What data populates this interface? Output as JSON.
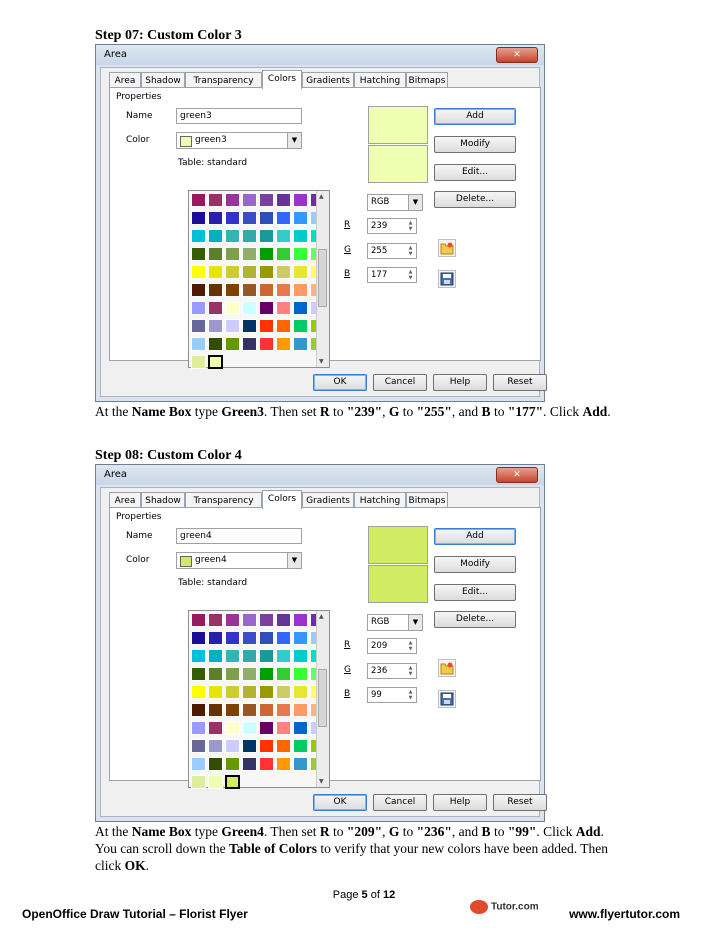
{
  "steps": [
    {
      "title": "Step 07: Custom Color 3",
      "dialog": {
        "title": "Area",
        "close": "✕",
        "tabs": [
          "Area",
          "Shadow",
          "Transparency",
          "Colors",
          "Gradients",
          "Hatching",
          "Bitmaps"
        ],
        "active_tab": "Colors",
        "group_label": "Properties",
        "name_label": "Name",
        "name_value": "green3",
        "color_label": "Color",
        "color_value": "green3",
        "color_swatch": "#efffb1",
        "table_label": "Table: standard",
        "preview_top": "#efffb1",
        "preview_bottom": "#efffb1",
        "buttons": {
          "add": "Add",
          "modify": "Modify",
          "edit": "Edit...",
          "delete": "Delete..."
        },
        "model": "RGB",
        "r_label": "R",
        "g_label": "G",
        "b_label": "B",
        "r": "239",
        "g": "255",
        "b": "177",
        "custom_cells": [
          "#dfee9b",
          "#efffb1"
        ],
        "selected_custom": 1,
        "footer_buttons": {
          "ok": "OK",
          "cancel": "Cancel",
          "help": "Help",
          "reset": "Reset"
        }
      },
      "paragraph_html": "At the <b>Name Box</b> type <b>Green3</b>. Then set <b>R</b> to <b>\"239\"</b>, <b>G</b> to <b>\"255\"</b>, and <b>B</b> to <b>\"177\"</b>. Click <b>Add</b>."
    },
    {
      "title": "Step 08: Custom Color 4",
      "dialog": {
        "title": "Area",
        "close": "✕",
        "tabs": [
          "Area",
          "Shadow",
          "Transparency",
          "Colors",
          "Gradients",
          "Hatching",
          "Bitmaps"
        ],
        "active_tab": "Colors",
        "group_label": "Properties",
        "name_label": "Name",
        "name_value": "green4",
        "color_label": "Color",
        "color_value": "green4",
        "color_swatch": "#d1ec63",
        "table_label": "Table: standard",
        "preview_top": "#d1ec63",
        "preview_bottom": "#d1ec63",
        "buttons": {
          "add": "Add",
          "modify": "Modify",
          "edit": "Edit...",
          "delete": "Delete..."
        },
        "model": "RGB",
        "r_label": "R",
        "g_label": "G",
        "b_label": "B",
        "r": "209",
        "g": "236",
        "b": "99",
        "custom_cells": [
          "#dfee9b",
          "#efffb1",
          "#d1ec63"
        ],
        "selected_custom": 2,
        "footer_buttons": {
          "ok": "OK",
          "cancel": "Cancel",
          "help": "Help",
          "reset": "Reset"
        }
      },
      "paragraph_html": "At the <b>Name Box</b> type <b>Green4</b>. Then set <b>R</b> to <b>\"209\"</b>, <b>G</b> to <b>\"236\"</b>, and <b>B</b> to <b>\"99\"</b>. Click <b>Add</b>. You can scroll down the <b>Table of Colors</b> to verify that your new colors have been added. Then click <b>OK</b>."
    }
  ],
  "palette_rows": [
    [
      "#99195e",
      "#993366",
      "#993399",
      "#9966cc",
      "#7b3f9e",
      "#663399",
      "#9933cc",
      "#6f2da8"
    ],
    [
      "#1e0d96",
      "#2a1fa8",
      "#3333cc",
      "#3b4dc8",
      "#2e4fb8",
      "#3366ff",
      "#3399ff",
      "#99ccff"
    ],
    [
      "#00c0d8",
      "#00b2bf",
      "#33b5b5",
      "#33aaaa",
      "#1a9999",
      "#33cccc",
      "#00cccc",
      "#00e0c0"
    ],
    [
      "#355e00",
      "#5b7f2a",
      "#7fa04a",
      "#8fae6a",
      "#00a000",
      "#33cc33",
      "#33ff33",
      "#66ff66"
    ],
    [
      "#ffff00",
      "#e6e600",
      "#cccc33",
      "#b2b233",
      "#999900",
      "#cccc66",
      "#e6e633",
      "#ffff66"
    ],
    [
      "#4d1a00",
      "#663300",
      "#804000",
      "#995522",
      "#cc6633",
      "#e67a4d",
      "#ff9966",
      "#ffb380"
    ],
    [
      "#9999ff",
      "#993366",
      "#ffffcc",
      "#ccffff",
      "#660066",
      "#ff8080",
      "#0066cc",
      "#ccccff"
    ],
    [
      "#666699",
      "#9999cc",
      "#ccccff",
      "#003366",
      "#ff3300",
      "#ff6600",
      "#00cc66",
      "#99cc00"
    ],
    [
      "#99ccff",
      "#334d00",
      "#669900",
      "#333366",
      "#ff3333",
      "#ff9900",
      "#3399cc",
      "#99cc33"
    ]
  ],
  "footer": {
    "page_prefix": "Page ",
    "page_num": "5",
    "page_of": " of ",
    "page_total": "12",
    "left": "OpenOffice Draw Tutorial – Florist Flyer",
    "logo": "Tutor.com",
    "right": "www.flyertutor.com"
  }
}
